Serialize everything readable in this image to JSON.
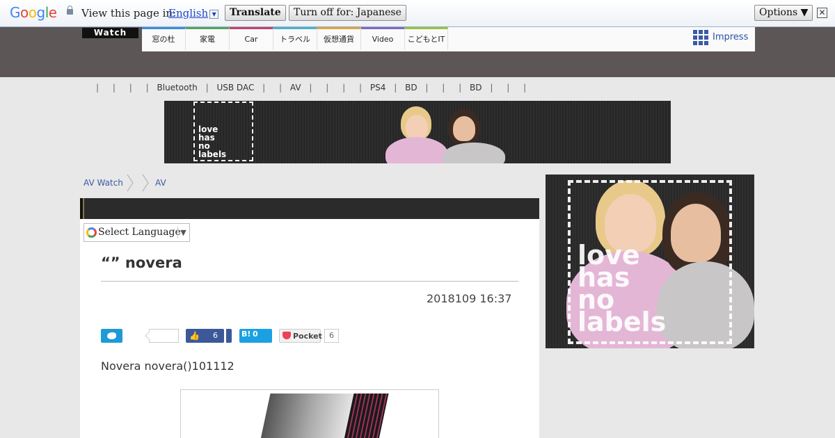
{
  "translate_bar": {
    "logo": "Google",
    "prompt": "View this page in:",
    "language": "English",
    "translate_button": "Translate",
    "turn_off_button": "Turn off for: Japanese",
    "options_button": "Options ▼",
    "close": "✕"
  },
  "header": {
    "logo": "Watch",
    "tabs": [
      {
        "label": "窓の杜",
        "color": "#3c8dd8"
      },
      {
        "label": "家電",
        "color": "#56a55c"
      },
      {
        "label": "Car",
        "color": "#c7406b"
      },
      {
        "label": "トラベル",
        "color": "#4db3c6"
      },
      {
        "label": "仮想通貨",
        "color": "#e0a33b"
      },
      {
        "label": "Video",
        "color": "#7b6bc2"
      },
      {
        "label": "こどもとIT",
        "color": "#9bc33d"
      }
    ],
    "impress": "Impress"
  },
  "subnav": {
    "items": [
      "",
      "",
      "",
      "",
      "Bluetooth",
      "USB DAC",
      "",
      "AV",
      "",
      "",
      "",
      "PS4",
      "BD",
      "",
      "",
      "BD",
      "",
      "",
      ""
    ]
  },
  "banner": {
    "text_lines": [
      "love",
      "has",
      "no",
      "labels"
    ]
  },
  "breadcrumb": {
    "items": [
      "AV Watch",
      "AV"
    ]
  },
  "article": {
    "select_language": "Select Language",
    "title": "“” novera",
    "date": "2018109 16:37",
    "share": {
      "fb_count": "6",
      "hatena_label": "B!",
      "hatena_count": "0",
      "pocket_label": "Pocket",
      "pocket_count": "6"
    },
    "body": "Novera novera()101112"
  },
  "side_ad": {
    "text_lines": [
      "love",
      "has",
      "no",
      "labels"
    ]
  }
}
